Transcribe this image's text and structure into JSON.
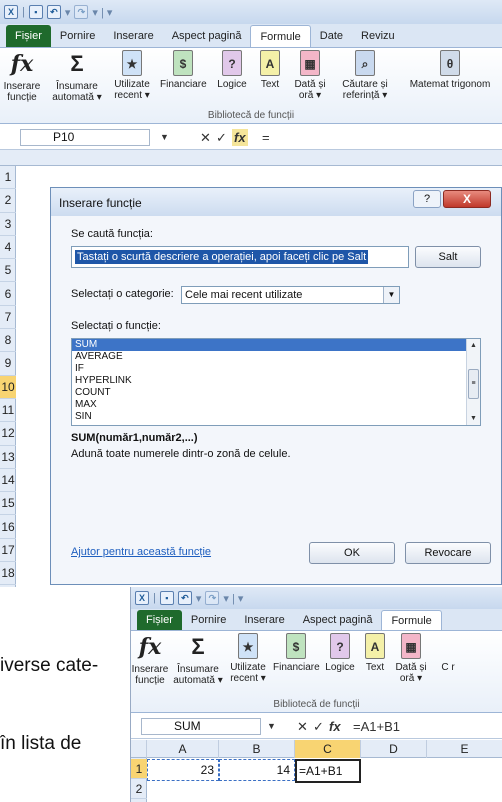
{
  "top_window": {
    "tabs": [
      "Fișier",
      "Pornire",
      "Inserare",
      "Aspect pagină",
      "Formule",
      "Date",
      "Revizu"
    ],
    "active_tab": "Formule",
    "ribbon": {
      "insert_function": "Inserare funcție",
      "autosum": "Însumare automată ▾",
      "recent": "Utilizate recent ▾",
      "financial": "Financiare",
      "logical": "Logice",
      "text": "Text",
      "datetime": "Dată și oră ▾",
      "lookup": "Căutare și referință ▾",
      "math": "Matemat trigonom",
      "group_label": "Bibliotecă de funcții"
    },
    "name_box": "P10",
    "formula_value": "=",
    "rows": [
      "1",
      "2",
      "3",
      "4",
      "5",
      "6",
      "7",
      "8",
      "9",
      "10",
      "11",
      "12",
      "13",
      "14",
      "15",
      "16",
      "17",
      "18"
    ],
    "selected_row": "10"
  },
  "dialog": {
    "title": "Inserare funcție",
    "help": "?",
    "close": "X",
    "search_label": "Se caută funcția:",
    "search_text": "Tastați o scurtă descriere a operației, apoi faceți clic pe Salt",
    "go_button": "Salt",
    "category_label": "Selectați o categorie:",
    "category_value": "Cele mai recent utilizate",
    "function_label": "Selectați o funcție:",
    "functions": [
      "SUM",
      "AVERAGE",
      "IF",
      "HYPERLINK",
      "COUNT",
      "MAX",
      "SIN"
    ],
    "selected_function": "SUM",
    "signature": "SUM(număr1,număr2,...)",
    "description": "Adună toate numerele dintr-o zonă de celule.",
    "help_link": "Ajutor pentru această funcție",
    "ok": "OK",
    "cancel": "Revocare"
  },
  "bottom_window": {
    "tabs": [
      "Fișier",
      "Pornire",
      "Inserare",
      "Aspect pagină",
      "Formule"
    ],
    "active_tab": "Formule",
    "ribbon": {
      "insert_function": "Inserare funcție",
      "autosum": "Însumare automată ▾",
      "recent": "Utilizate recent ▾",
      "financial": "Financiare",
      "logical": "Logice",
      "text": "Text",
      "datetime": "Dată și oră ▾",
      "lookup": "C r",
      "group_label": "Bibliotecă de funcții"
    },
    "name_box": "SUM",
    "formula_value": "=A1+B1",
    "columns": [
      "A",
      "B",
      "C",
      "D",
      "E"
    ],
    "rows": [
      "1",
      "2"
    ],
    "cells": {
      "A1": "23",
      "B1": "14",
      "C1": "=A1+B1"
    }
  },
  "page_text": {
    "line1": "iverse cate-",
    "line2": "în lista de"
  }
}
